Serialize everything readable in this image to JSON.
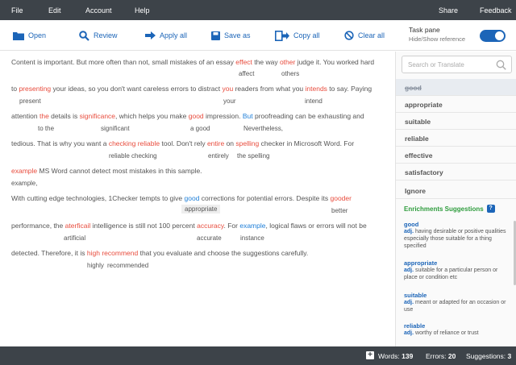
{
  "menu": {
    "file": "File",
    "edit": "Edit",
    "account": "Account",
    "help": "Help",
    "share": "Share",
    "feedback": "Feedback"
  },
  "toolbar": {
    "open": "Open",
    "review": "Review",
    "apply_all": "Apply all",
    "save_as": "Save as",
    "copy_all": "Copy all",
    "clear_all": "Clear all",
    "task_pane_title": "Task pane",
    "task_pane_sub": "Hide/Show reference",
    "task_pane_on": true,
    "accent": "#1c65b8"
  },
  "editor": {
    "lines": [
      {
        "segments": [
          {
            "t": "Content is important. But more often than not, small mistakes of an essay ",
            "c": ""
          },
          {
            "t": "effect",
            "c": "err"
          },
          {
            "t": " the way ",
            "c": ""
          },
          {
            "t": "other",
            "c": "err"
          },
          {
            "t": " judge it. You worked hard",
            "c": ""
          }
        ]
      },
      {
        "segments": [
          {
            "t": "to ",
            "c": ""
          },
          {
            "t": "presenting",
            "c": "err"
          },
          {
            "t": " your ideas, so you don't want careless errors to distract ",
            "c": ""
          },
          {
            "t": "you",
            "c": "err"
          },
          {
            "t": " readers from what you ",
            "c": ""
          },
          {
            "t": "intends",
            "c": "err"
          },
          {
            "t": " to say. Paying",
            "c": ""
          }
        ]
      },
      {
        "segments": [
          {
            "t": "attention ",
            "c": ""
          },
          {
            "t": "the",
            "c": "err"
          },
          {
            "t": " details is ",
            "c": ""
          },
          {
            "t": "significance",
            "c": "err"
          },
          {
            "t": ", which helps you make ",
            "c": ""
          },
          {
            "t": "good",
            "c": "err"
          },
          {
            "t": " impression. ",
            "c": ""
          },
          {
            "t": "But",
            "c": "blu"
          },
          {
            "t": " proofreading can be exhausting and",
            "c": ""
          }
        ]
      },
      {
        "segments": [
          {
            "t": "tedious. That is why you want a ",
            "c": ""
          },
          {
            "t": "checking reliable",
            "c": "err"
          },
          {
            "t": " tool. Don't rely ",
            "c": ""
          },
          {
            "t": "entire",
            "c": "err"
          },
          {
            "t": " on ",
            "c": ""
          },
          {
            "t": "spelling",
            "c": "err"
          },
          {
            "t": " checker in Microsoft Word. For",
            "c": ""
          }
        ]
      },
      {
        "segments": [
          {
            "t": "example",
            "c": "err"
          },
          {
            "t": " MS Word cannot detect most mistakes in this sample.",
            "c": ""
          }
        ]
      },
      {
        "segments": [
          {
            "t": "With cutting edge technologies, 1Checker tempts to give ",
            "c": ""
          },
          {
            "t": "good",
            "c": "blu"
          },
          {
            "t": " corrections for potential errors. Despite its ",
            "c": ""
          },
          {
            "t": "gooder",
            "c": "err"
          }
        ]
      },
      {
        "segments": [
          {
            "t": "performance, the ",
            "c": ""
          },
          {
            "t": "aterficail",
            "c": "err"
          },
          {
            "t": " intelligence is still not 100 percent ",
            "c": ""
          },
          {
            "t": "accuracy",
            "c": "err"
          },
          {
            "t": ". For ",
            "c": ""
          },
          {
            "t": "example",
            "c": "blu"
          },
          {
            "t": ", logical flaws or errors will not be",
            "c": ""
          }
        ]
      },
      {
        "segments": [
          {
            "t": "detected. Therefore, it is ",
            "c": ""
          },
          {
            "t": "high",
            "c": "err"
          },
          {
            "t": "   ",
            "c": ""
          },
          {
            "t": "recommend",
            "c": "err"
          },
          {
            "t": " that you evaluate and choose the suggestions carefully.",
            "c": ""
          }
        ]
      }
    ],
    "suggestions": [
      {
        "t": "affect"
      },
      {
        "t": "others"
      },
      {
        "t": "present"
      },
      {
        "t": "your"
      },
      {
        "t": "intend"
      },
      {
        "t": "to the"
      },
      {
        "t": "significant"
      },
      {
        "t": "a good"
      },
      {
        "t": "Nevertheless,"
      },
      {
        "t": "reliable checking"
      },
      {
        "t": "entirely"
      },
      {
        "t": "the spelling"
      },
      {
        "t": "example,"
      },
      {
        "t": "appropriate"
      },
      {
        "t": "better"
      },
      {
        "t": "artificial"
      },
      {
        "t": "accurate"
      },
      {
        "t": "instance"
      },
      {
        "t": "highly"
      },
      {
        "t": "recommended"
      }
    ],
    "error_color": "#e84c3d",
    "info_color": "#1f7fd8"
  },
  "pane": {
    "search_placeholder": "Search or Translate",
    "options": [
      "good",
      "appropriate",
      "suitable",
      "reliable",
      "effective",
      "satisfactory",
      "Ignore"
    ],
    "enrichments_title": "Enrichments Suggestions",
    "definitions": [
      {
        "word": "good",
        "pos": "adj.",
        "text": "having desirable or positive qualities especially those suitable for a thing specified"
      },
      {
        "word": "appropriate",
        "pos": "adj.",
        "text": "suitable for a particular person or place or condition etc"
      },
      {
        "word": "suitable",
        "pos": "adj.",
        "text": "meant or adapted for an occasion or use"
      },
      {
        "word": "reliable",
        "pos": "adj.",
        "text": "worthy of reliance or trust"
      }
    ]
  },
  "status": {
    "words_label": "Words:",
    "words": "139",
    "errors_label": "Errors:",
    "errors": "20",
    "suggestions_label": "Suggestions:",
    "suggestions": "3"
  }
}
